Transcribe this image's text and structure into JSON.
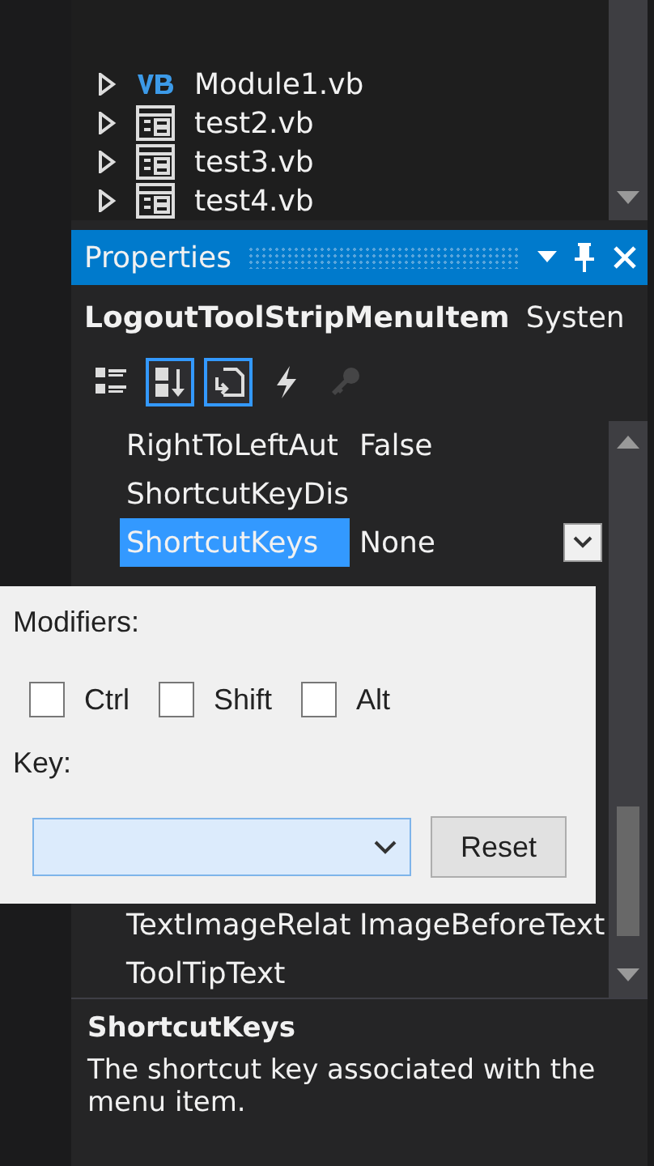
{
  "solution_explorer": {
    "items": [
      {
        "label": "Module1.vb",
        "kind": "module",
        "expanded": false
      },
      {
        "label": "test2.vb",
        "kind": "form",
        "expanded": false
      },
      {
        "label": "test3.vb",
        "kind": "form",
        "expanded": false
      },
      {
        "label": "test4.vb",
        "kind": "form",
        "expanded": false
      }
    ]
  },
  "properties": {
    "title": "Properties",
    "object": "LogoutToolStripMenuItem",
    "object_type": "Systen",
    "toolbar": [
      {
        "kind": "categorized",
        "selected": false,
        "disabled": false
      },
      {
        "kind": "alphabetical",
        "selected": true,
        "disabled": false
      },
      {
        "kind": "properties",
        "selected": true,
        "disabled": false
      },
      {
        "kind": "events",
        "selected": false,
        "disabled": false
      },
      {
        "kind": "pages",
        "selected": false,
        "disabled": true
      }
    ],
    "rows_top": [
      {
        "name": "RightToLeftAut",
        "value": "False",
        "selected": false
      },
      {
        "name": "ShortcutKeyDis",
        "selected": false
      },
      {
        "name": "ShortcutKeys",
        "value": "None",
        "selected": true
      }
    ],
    "rows_bottom": [
      {
        "name": "TextImageRelat",
        "value": "ImageBeforeText",
        "selected": false
      },
      {
        "name": "ToolTipText",
        "selected": false
      }
    ],
    "description": {
      "title": "ShortcutKeys",
      "text": "The shortcut key associated with the menu item."
    }
  },
  "shortcut_editor": {
    "modifiers_label": "Modifiers:",
    "modifiers": [
      {
        "label": "Ctrl",
        "checked": false
      },
      {
        "label": "Shift",
        "checked": false
      },
      {
        "label": "Alt",
        "checked": false
      }
    ],
    "key_label": "Key:",
    "reset_button": "Reset"
  }
}
